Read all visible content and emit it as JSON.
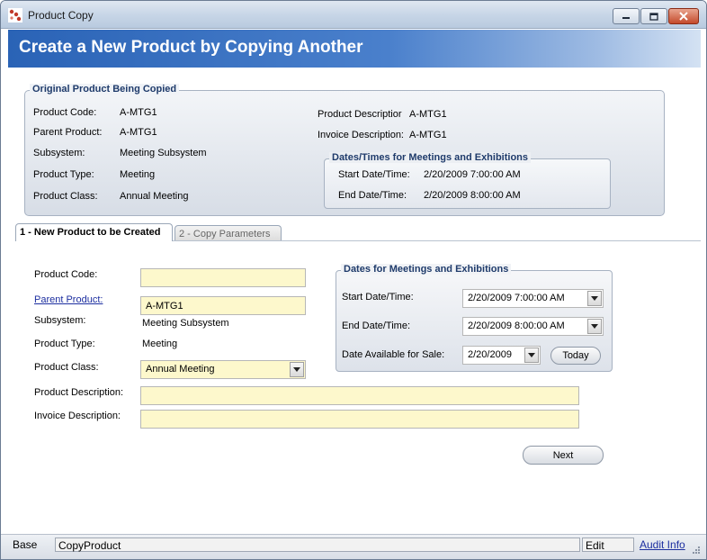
{
  "window": {
    "title": "Product Copy"
  },
  "banner": {
    "title": "Create a New Product by Copying Another"
  },
  "original": {
    "legend": "Original Product Being Copied",
    "fields": [
      {
        "label": "Product Code:",
        "value": "A-MTG1"
      },
      {
        "label": "Parent Product:",
        "value": "A-MTG1"
      },
      {
        "label": "Subsystem:",
        "value": "Meeting Subsystem"
      },
      {
        "label": "Product Type:",
        "value": "Meeting"
      },
      {
        "label": "Product Class:",
        "value": "Annual Meeting"
      }
    ],
    "product_description": {
      "label": "Product Descriptior",
      "value": "A-MTG1"
    },
    "invoice_description": {
      "label": "Invoice Description:",
      "value": "A-MTG1"
    },
    "dates": {
      "legend": "Dates/Times for Meetings and Exhibitions",
      "start": {
        "label": "Start Date/Time:",
        "value": "2/20/2009 7:00:00 AM"
      },
      "end": {
        "label": "End Date/Time:",
        "value": "2/20/2009 8:00:00 AM"
      }
    }
  },
  "tabs": [
    {
      "label": "1 - New Product to be Created",
      "active": true
    },
    {
      "label": "2 - Copy Parameters",
      "active": false
    }
  ],
  "form": {
    "product_code": {
      "label": "Product Code:",
      "value": ""
    },
    "parent_product": {
      "label": "Parent Product:",
      "value": "A-MTG1"
    },
    "subsystem": {
      "label": "Subsystem:",
      "value": "Meeting Subsystem"
    },
    "product_type": {
      "label": "Product Type:",
      "value": "Meeting"
    },
    "product_class": {
      "label": "Product Class:",
      "value": "Annual Meeting"
    },
    "product_description": {
      "label": "Product Description:",
      "value": ""
    },
    "invoice_description": {
      "label": "Invoice Description:",
      "value": ""
    },
    "dates": {
      "legend": "Dates for Meetings and Exhibitions",
      "start": {
        "label": "Start Date/Time:",
        "value": "2/20/2009 7:00:00 AM"
      },
      "end": {
        "label": "End Date/Time:",
        "value": "2/20/2009 8:00:00 AM"
      },
      "available": {
        "label": "Date Available for Sale:",
        "value": "2/20/2009"
      },
      "today_label": "Today"
    },
    "next_label": "Next"
  },
  "status": {
    "base": "Base",
    "process": "CopyProduct",
    "mode": "Edit",
    "audit": "Audit Info"
  },
  "colors": {
    "field_bg": "#fdf8cc",
    "banner_blue": "#2a63b6",
    "legend_blue": "#1f3b6b",
    "link_blue": "#1d2fa0"
  }
}
